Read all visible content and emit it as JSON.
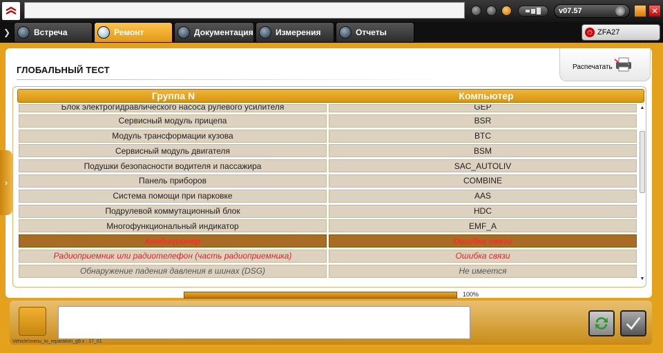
{
  "topbar": {
    "version": "v07.57"
  },
  "tabs": [
    {
      "label": "Встреча",
      "active": false
    },
    {
      "label": "Ремонт",
      "active": true
    },
    {
      "label": "Документация",
      "active": false
    },
    {
      "label": "Измерения",
      "active": false
    },
    {
      "label": "Отчеты",
      "active": false
    }
  ],
  "vin": "ZFA27",
  "page": {
    "title": "ГЛОБАЛЬНЫЙ ТЕСТ",
    "print_label": "Распечатать"
  },
  "table": {
    "headers": [
      "Группа N",
      "Компьютер"
    ],
    "rows": [
      {
        "group": "Блок электрогидравлического насоса рулевого усилителя",
        "computer": "GEP",
        "status": "normal"
      },
      {
        "group": "Сервисный модуль прицепа",
        "computer": "BSR",
        "status": "normal"
      },
      {
        "group": "Модуль трансформации кузова",
        "computer": "BTC",
        "status": "normal"
      },
      {
        "group": "Сервисный модуль двигателя",
        "computer": "BSM",
        "status": "normal"
      },
      {
        "group": "Подушки безопасности водителя и пассажира",
        "computer": "SAC_AUTOLIV",
        "status": "normal"
      },
      {
        "group": "Панель приборов",
        "computer": "COMBINE",
        "status": "normal"
      },
      {
        "group": "Система помощи при парковке",
        "computer": "AAS",
        "status": "normal"
      },
      {
        "group": "Подрулевой коммутационный блок",
        "computer": "HDC",
        "status": "normal"
      },
      {
        "group": "Многофункциональный индикатор",
        "computer": "EMF_A",
        "status": "normal"
      },
      {
        "group": "Кондиционер",
        "computer": "Ошибка связи",
        "status": "err-hi"
      },
      {
        "group": "Радиоприемник или радиотелефон (часть радиоприемника)",
        "computer": "Ошибка связи",
        "status": "err"
      },
      {
        "group": "Обнаружение падения давления в шинах (DSG)",
        "computer": "Не имеется",
        "status": "na"
      }
    ]
  },
  "progress": {
    "value": 1.0,
    "label": "100%"
  },
  "status_path": "Vehicle\\menu_to_reparation_g9.s : 17_01",
  "colors": {
    "accent": "#e3a11c",
    "error": "#e82020"
  }
}
